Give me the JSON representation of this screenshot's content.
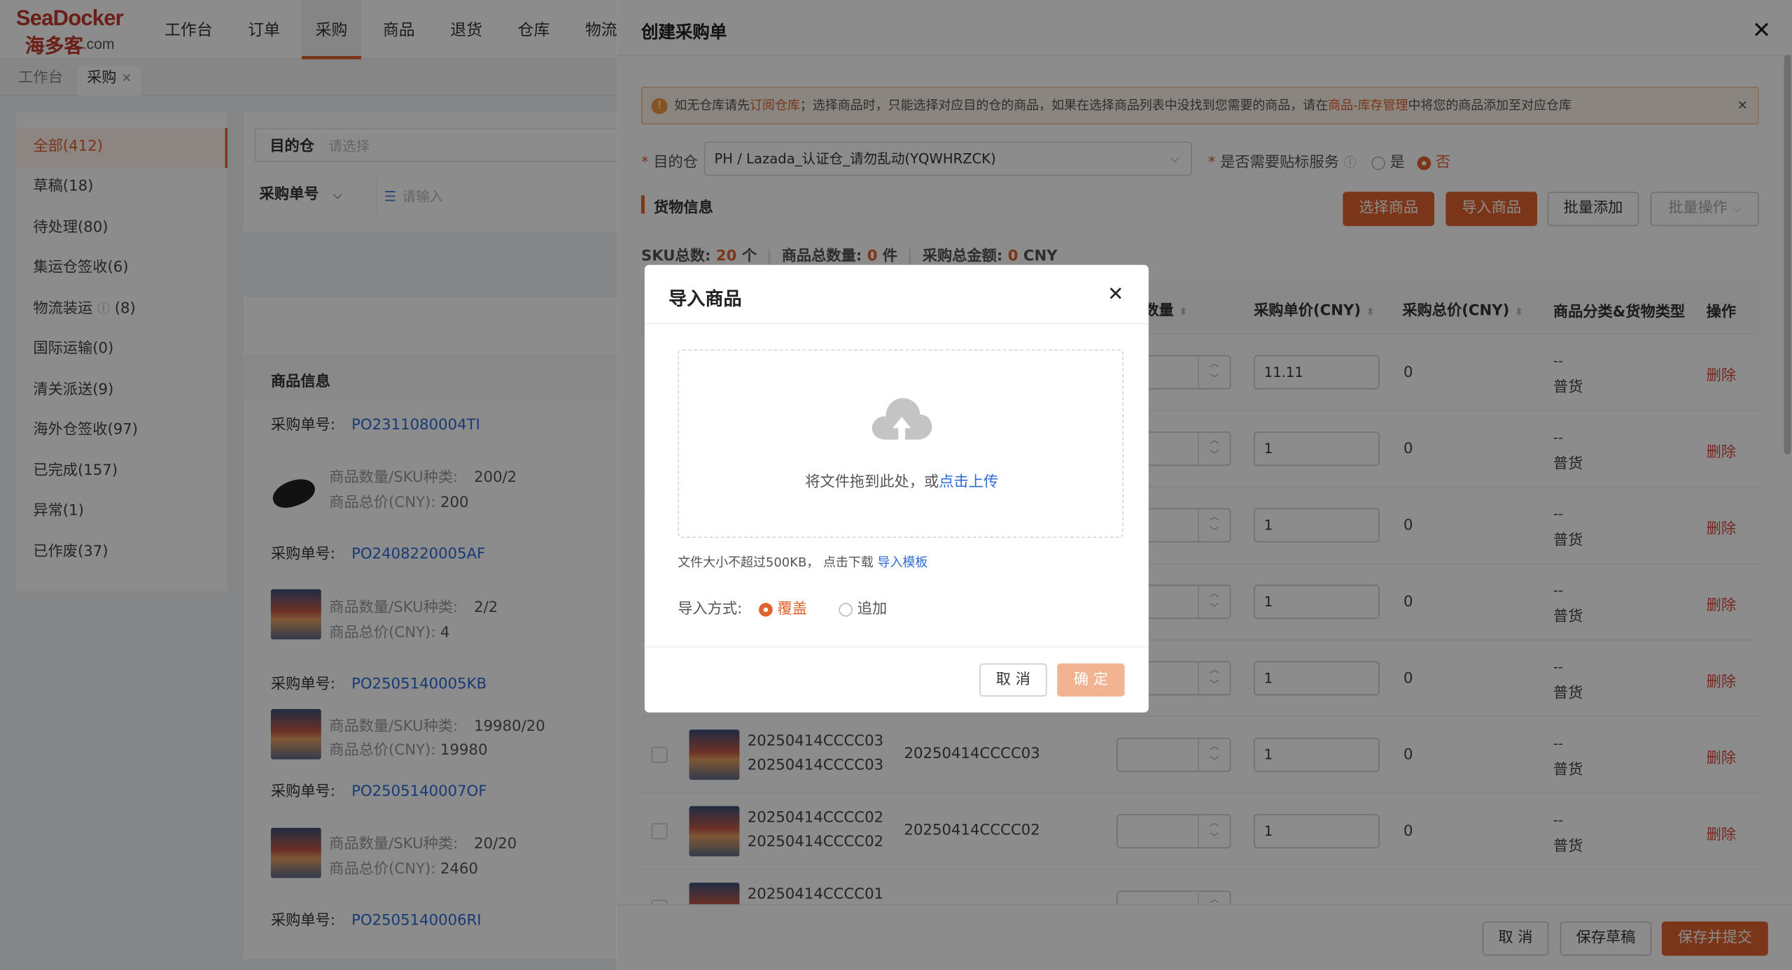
{
  "brand": {
    "logo_en": "SeaDocker",
    "logo_cn": "海多客",
    "logo_dom": ".com",
    "colors": {
      "accent": "#e0622c",
      "link": "#2d6ad6",
      "danger": "#d9453b"
    }
  },
  "nav": [
    "工作台",
    "订单",
    "采购",
    "商品",
    "退货",
    "仓库",
    "物流"
  ],
  "tabs": [
    "工作台",
    "采购"
  ],
  "status_list": [
    {
      "label": "全部(412)"
    },
    {
      "label": "草稿(18)"
    },
    {
      "label": "待处理(80)"
    },
    {
      "label": "集运仓签收(6)"
    },
    {
      "label": "物流装运"
    },
    {
      "label": "国际运输(0)"
    },
    {
      "label": "清关派送(9)"
    },
    {
      "label": "海外仓签收(97)"
    },
    {
      "label": "已完成(157)"
    },
    {
      "label": "异常(1)"
    },
    {
      "label": "已作废(37)"
    }
  ],
  "status_logistics_count": "(8)",
  "filter": {
    "warehouse_label": "目的仓",
    "warehouse_placeholder": "请选择",
    "order_type": "采购单号",
    "order_placeholder": "请输入"
  },
  "list": {
    "header": "商品信息",
    "order_label": "采购单号:",
    "qty_label": "商品数量/SKU种类:",
    "total_label": "商品总价(CNY):",
    "orders": [
      {
        "no": "PO2311080004TI",
        "qty": "200/2",
        "total": "200"
      },
      {
        "no": "PO2408220005AF",
        "qty": "2/2",
        "total": "4"
      },
      {
        "no": "PO2505140005KB",
        "qty": "19980/20",
        "total": "19980"
      },
      {
        "no": "PO2505140007OF",
        "qty": "20/20",
        "total": "2460"
      },
      {
        "no": "PO2505140006RI"
      }
    ]
  },
  "drawer": {
    "title": "创建采购单",
    "close": "✕",
    "notice_pre": "如无仓库请先",
    "notice_link1": "订阅仓库",
    "notice_mid": "；选择商品时，只能选择对应目的仓的商品，如果在选择商品列表中没找到您需要的商品，请在",
    "notice_link2": "商品-库存管理",
    "notice_post": "中将您的商品添加至对应仓库",
    "warehouse_label": "目的仓",
    "warehouse_value": "PH / Lazada_认证仓_请勿乱动(YQWHRZCK)",
    "label_service": "是否需要贴标服务",
    "yes": "是",
    "no": "否",
    "section": "货物信息",
    "btn_select": "选择商品",
    "btn_import": "导入商品",
    "btn_batch_add": "批量添加",
    "btn_batch_op": "批量操作",
    "sku_label": "SKU总数:",
    "sku_value": "20",
    "sku_unit": "个",
    "qty_label": "商品总数量:",
    "qty_value": "0",
    "qty_unit": "件",
    "amount_label": "采购总金额:",
    "amount_value": "0",
    "amount_unit": "CNY",
    "columns": {
      "qty": "数量",
      "price": "采购单价(CNY)",
      "total": "采购总价(CNY)",
      "category": "商品分类&货物类型",
      "op": "操作"
    },
    "rows": [
      {
        "price": "11.11",
        "total": "0",
        "cat": "--",
        "type": "普货",
        "op": "删除"
      },
      {
        "price": "1",
        "total": "0",
        "cat": "--",
        "type": "普货",
        "op": "删除"
      },
      {
        "price": "1",
        "total": "0",
        "cat": "--",
        "type": "普货",
        "op": "删除"
      },
      {
        "price": "1",
        "total": "0",
        "cat": "--",
        "type": "普货",
        "op": "删除"
      },
      {
        "price": "1",
        "total": "0",
        "cat": "--",
        "type": "普货",
        "op": "删除"
      },
      {
        "name1": "20250414CCCC03",
        "name2": "20250414CCCC03",
        "sku": "20250414CCCC03",
        "price": "1",
        "total": "0",
        "cat": "--",
        "type": "普货",
        "op": "删除"
      },
      {
        "name1": "20250414CCCC02",
        "name2": "20250414CCCC02",
        "sku": "20250414CCCC02",
        "price": "1",
        "total": "0",
        "cat": "--",
        "type": "普货",
        "op": "删除"
      },
      {
        "name1": "20250414CCCC01"
      }
    ],
    "footer": {
      "cancel": "取 消",
      "draft": "保存草稿",
      "submit": "保存并提交"
    }
  },
  "modal": {
    "title": "导入商品",
    "close": "✕",
    "drop_text": "将文件拖到此处，或",
    "drop_link": "点击上传",
    "hint": "文件大小不超过500KB，  点击下载",
    "hint_link": "导入模板",
    "mode_label": "导入方式:",
    "mode_overwrite": "覆盖",
    "mode_append": "追加",
    "cancel": "取 消",
    "confirm": "确 定"
  }
}
